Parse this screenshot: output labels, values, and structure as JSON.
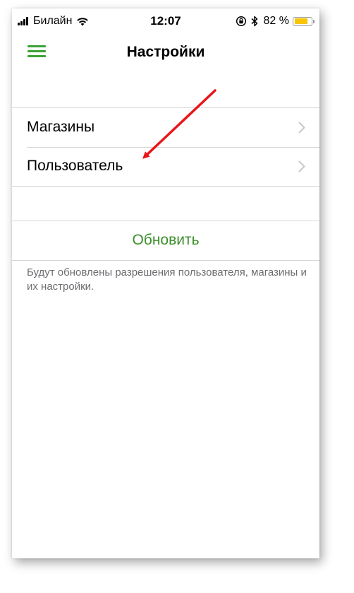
{
  "status_bar": {
    "carrier": "Билайн",
    "time": "12:07",
    "battery_percent": "82 %",
    "battery_level": 0.82,
    "icons": [
      "signal-icon",
      "wifi-icon",
      "rotation-lock-icon",
      "bluetooth-icon",
      "battery-icon"
    ]
  },
  "header": {
    "title": "Настройки",
    "menu_icon": "hamburger-menu-icon",
    "accent_color": "#3aa335"
  },
  "settings_list": {
    "items": [
      {
        "label": "Магазины"
      },
      {
        "label": "Пользователь"
      }
    ]
  },
  "refresh": {
    "label": "Обновить",
    "color": "#3a8f2a",
    "note": "Будут обновлены разрешения пользователя, магазины и их настройки."
  },
  "annotation": {
    "type": "red-arrow",
    "color": "#e8161b",
    "points_to": "Пользователь"
  }
}
